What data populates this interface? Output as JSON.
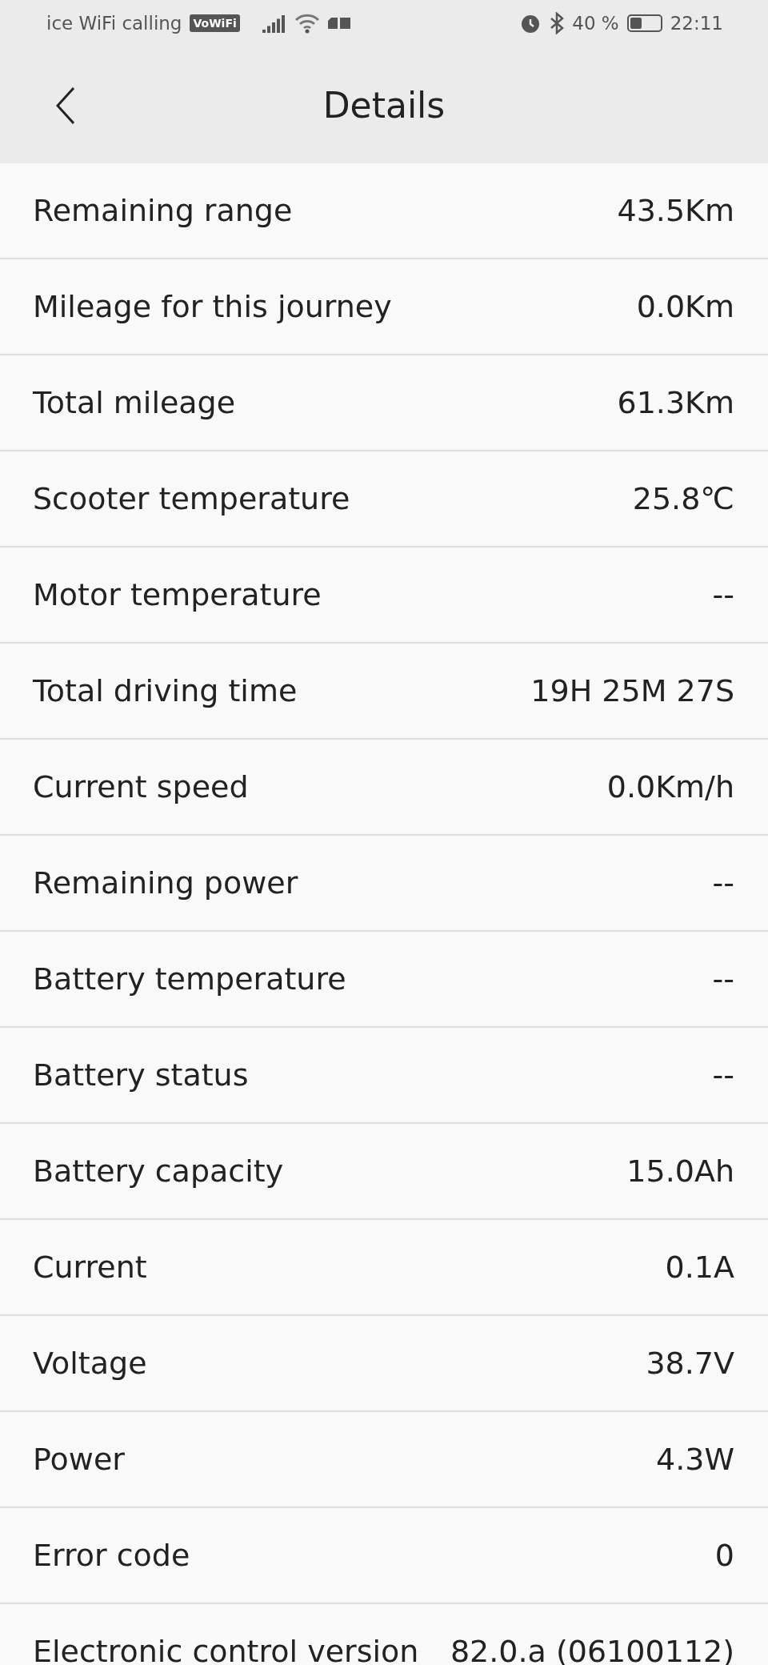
{
  "status_bar": {
    "carrier": "ice WiFi calling",
    "vowifi_badge": "VoWiFi",
    "battery_percent": "40 %",
    "time": "22:11"
  },
  "header": {
    "title": "Details"
  },
  "rows": [
    {
      "label": "Remaining range",
      "value": "43.5Km"
    },
    {
      "label": "Mileage for this journey",
      "value": "0.0Km"
    },
    {
      "label": "Total mileage",
      "value": "61.3Km"
    },
    {
      "label": "Scooter temperature",
      "value": "25.8℃"
    },
    {
      "label": "Motor temperature",
      "value": "--"
    },
    {
      "label": "Total driving time",
      "value": "19H 25M 27S"
    },
    {
      "label": "Current speed",
      "value": "0.0Km/h"
    },
    {
      "label": "Remaining power",
      "value": "--"
    },
    {
      "label": "Battery temperature",
      "value": "--"
    },
    {
      "label": "Battery status",
      "value": "--"
    },
    {
      "label": "Battery capacity",
      "value": "15.0Ah"
    },
    {
      "label": "Current",
      "value": "0.1A"
    },
    {
      "label": "Voltage",
      "value": "38.7V"
    },
    {
      "label": "Power",
      "value": "4.3W"
    },
    {
      "label": "Error code",
      "value": "0"
    },
    {
      "label": "Electronic control version",
      "value": "82.0.a (06100112)"
    }
  ]
}
